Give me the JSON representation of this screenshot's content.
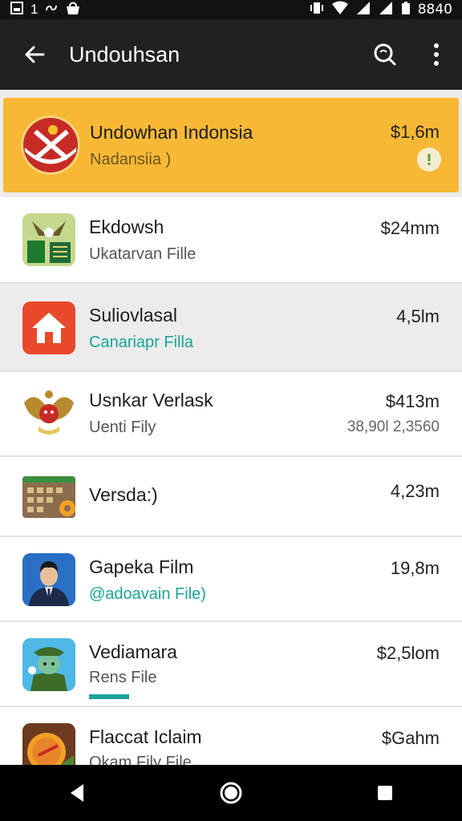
{
  "status_bar": {
    "left_text": "1",
    "time": "8840"
  },
  "app_bar": {
    "title": "Undouhsan"
  },
  "items": [
    {
      "name": "Undowhan Indonsia",
      "subtitle": "Nadansiia )",
      "size": "$1,6m"
    },
    {
      "name": "Ekdowsh",
      "subtitle": "Ukatarvan Fille",
      "size": "$24mm"
    },
    {
      "name": "Suliovlasal",
      "subtitle": "Canariapr Filla",
      "size": "4,5lm"
    },
    {
      "name": "Usnkar Verlask",
      "subtitle": "Uenti Fily",
      "size": "$413m",
      "extra": "38,90l 2,3560"
    },
    {
      "name": "Versda:)",
      "subtitle": "",
      "size": "4,23m"
    },
    {
      "name": "Gapeka Film",
      "subtitle": "@adoavain File)",
      "size": "19,8m"
    },
    {
      "name": "Vediamara",
      "subtitle": "Rens File",
      "size": "$2,5lom",
      "progress": 0.3
    },
    {
      "name": "Flaccat Iclaim",
      "subtitle": "Okam Fily File",
      "size": "$Gahm"
    }
  ],
  "colors": {
    "highlight": "#f7b835",
    "accent": "#1aa39a",
    "app_bar": "#212121"
  }
}
